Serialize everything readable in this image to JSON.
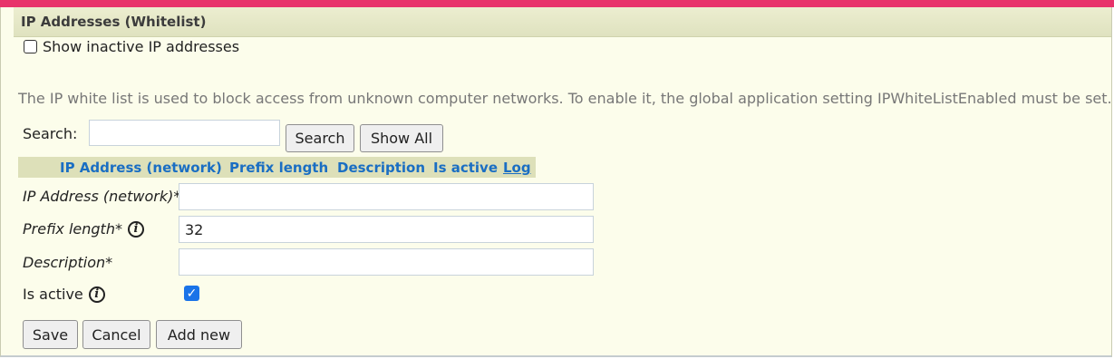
{
  "panel": {
    "title": "IP Addresses (Whitelist)"
  },
  "filter": {
    "show_inactive_label": "Show inactive IP addresses",
    "show_inactive_checked": false
  },
  "info_text": "The IP white list is used to block access from unknown computer networks. To enable it, the global application setting IPWhiteListEnabled must be set.",
  "search": {
    "label": "Search:",
    "value": "",
    "search_button": "Search",
    "show_all_button": "Show All"
  },
  "table": {
    "columns": [
      "IP Address (network)",
      "Prefix length",
      "Description",
      "Is active",
      "Log"
    ]
  },
  "form": {
    "ip_label": "IP Address (network)*",
    "ip_value": "",
    "prefix_label": "Prefix length*",
    "prefix_value": "32",
    "description_label": "Description*",
    "description_value": "",
    "is_active_label": "Is active",
    "is_active_checked": true,
    "info_icon_glyph": "i"
  },
  "actions": {
    "save": "Save",
    "cancel": "Cancel",
    "add_new": "Add new"
  },
  "colors": {
    "accent_bar": "#e8336b",
    "panel_bg": "#fcfdeb",
    "header_bg": "#dde0b9",
    "link": "#1a6ec3",
    "checkbox": "#1a73e8"
  }
}
